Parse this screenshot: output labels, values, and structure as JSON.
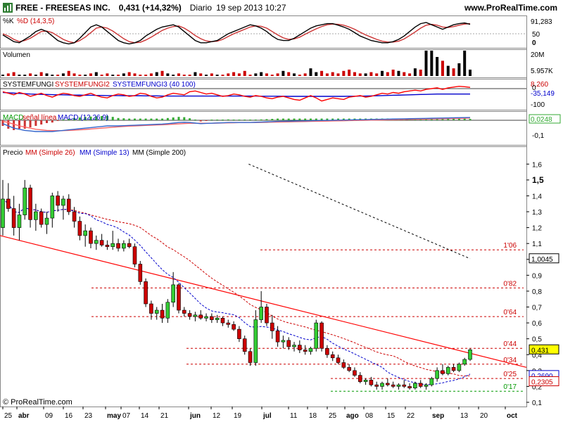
{
  "header": {
    "ticker_line": "FREE - FREESEAS INC.",
    "last_price": "0,431 (+14,32%)",
    "period": "Diario",
    "timestamp": "19 sep 2013 10:27",
    "site": "www.ProRealTime.com"
  },
  "footer": "© ProRealTime.com",
  "colors": {
    "up": "#33cc33",
    "down": "#cc0000",
    "mm26": "#cc0000",
    "mm13": "#0000cc",
    "mm200": "#000000",
    "trendline": "#ff0000",
    "level": "#cc0000",
    "support": "#009900"
  },
  "x_axis": {
    "labels": [
      "25",
      "abr",
      "09",
      "16",
      "23",
      "may",
      "07",
      "14",
      "21",
      "jun",
      "12",
      "19",
      "jul",
      "11",
      "18",
      "25",
      "ago",
      "08",
      "15",
      "22",
      "sep",
      "13",
      "20",
      "oct"
    ]
  },
  "panels": {
    "stoch": {
      "label_k": "%K",
      "label_d": "%D (14,3,5)",
      "value": "91,283",
      "ticks": [
        "50",
        "0"
      ],
      "k": [
        45,
        30,
        15,
        10,
        25,
        40,
        60,
        70,
        60,
        40,
        20,
        10,
        5,
        10,
        30,
        55,
        80,
        90,
        80,
        60,
        40,
        20,
        10,
        5,
        10,
        20,
        40,
        55,
        70,
        80,
        85,
        90,
        80,
        60,
        40,
        20,
        10,
        10,
        15,
        20,
        35,
        50,
        60,
        70,
        80,
        90,
        85,
        75,
        60,
        40,
        25,
        20,
        20,
        30,
        45,
        60,
        75,
        85,
        90,
        95,
        95,
        88,
        80,
        70,
        55,
        40,
        30,
        20,
        15,
        10,
        10,
        15,
        25,
        40,
        60,
        80,
        95,
        100,
        90,
        80,
        70,
        80,
        90,
        95,
        98,
        92
      ],
      "d": [
        50,
        40,
        25,
        15,
        20,
        30,
        45,
        60,
        62,
        55,
        40,
        25,
        15,
        10,
        20,
        35,
        55,
        75,
        80,
        75,
        62,
        45,
        28,
        15,
        10,
        12,
        22,
        35,
        50,
        65,
        75,
        82,
        85,
        75,
        60,
        42,
        28,
        18,
        15,
        17,
        25,
        38,
        50,
        60,
        70,
        80,
        85,
        83,
        75,
        60,
        45,
        32,
        25,
        27,
        35,
        48,
        60,
        72,
        82,
        90,
        93,
        92,
        88,
        80,
        70,
        57,
        45,
        35,
        25,
        17,
        13,
        13,
        17,
        27,
        42,
        58,
        75,
        88,
        92,
        88,
        80,
        78,
        82,
        88,
        93,
        95
      ]
    },
    "volume": {
      "label": "Volumen",
      "ticks": [
        "20M",
        "5.957K"
      ],
      "values": [
        1,
        2,
        3,
        1,
        1,
        2,
        1,
        3,
        2,
        1,
        1,
        2,
        4,
        2,
        1,
        1,
        2,
        3,
        1,
        2,
        1,
        1,
        2,
        3,
        2,
        1,
        1,
        2,
        3,
        4,
        2,
        1,
        2,
        1,
        1,
        3,
        2,
        1,
        2,
        1,
        1,
        2,
        3,
        2,
        4,
        1,
        2,
        3,
        2,
        1,
        2,
        4,
        3,
        2,
        1,
        2,
        6,
        3,
        4,
        2,
        3,
        2,
        4,
        5,
        3,
        2,
        2,
        3,
        2,
        4,
        3,
        5,
        4,
        3,
        2,
        6,
        5,
        20,
        20,
        15,
        12,
        8,
        6,
        10,
        20,
        5
      ]
    },
    "sysfungi": {
      "label_1": "SYSTEMFUNGI",
      "label_2": "SYSTEMFUNGI2",
      "label_3": "SYSTEMFUNGI3 (40 100)",
      "value_1": "8,260",
      "value_2": "-35,149",
      "ticks": [
        "0",
        "-100"
      ],
      "red": [
        -20,
        -30,
        -40,
        -25,
        -35,
        -50,
        -40,
        -30,
        -45,
        -55,
        -40,
        -30,
        -35,
        -45,
        -50,
        -40,
        -30,
        -45,
        -55,
        -60,
        -45,
        -35,
        -40,
        -50,
        -45,
        -30,
        -35,
        -50,
        -60,
        -55,
        -40,
        -30,
        -35,
        -40,
        -20,
        -15,
        -25,
        -35,
        -30,
        -40,
        -50,
        -45,
        -35,
        -40,
        -50,
        -55,
        -45,
        -50,
        -60,
        -65,
        -55,
        -50,
        -60,
        -70,
        -75,
        -60,
        -45,
        -60,
        -80,
        -70,
        -60,
        -65,
        -70,
        -55,
        -50,
        -45,
        -55,
        -50,
        -40,
        -30,
        -35,
        -25,
        -30,
        -20,
        -15,
        -10,
        -15,
        -5,
        0,
        5,
        -5,
        5,
        10,
        15,
        12,
        8
      ],
      "blue": [
        -25,
        -27,
        -29,
        -31,
        -33,
        -35,
        -36,
        -37,
        -38,
        -39,
        -40,
        -40,
        -41,
        -42,
        -42,
        -43,
        -43,
        -44,
        -44,
        -45,
        -45,
        -45,
        -46,
        -46,
        -46,
        -46,
        -47,
        -47,
        -47,
        -48,
        -48,
        -48,
        -48,
        -48,
        -48,
        -48,
        -48,
        -48,
        -48,
        -48,
        -48,
        -48,
        -48,
        -48,
        -48,
        -48,
        -48,
        -49,
        -49,
        -49,
        -49,
        -49,
        -50,
        -50,
        -50,
        -50,
        -50,
        -50,
        -50,
        -50,
        -50,
        -50,
        -50,
        -49,
        -49,
        -48,
        -48,
        -47,
        -46,
        -45,
        -44,
        -43,
        -42,
        -41,
        -40,
        -39,
        -38,
        -37,
        -36,
        -35,
        -35,
        -35,
        -35,
        -35,
        -35,
        -35
      ]
    },
    "macd": {
      "label_1": "MACD",
      "label_2": "señal línea",
      "label_3": "MACD (12,26,9)",
      "value": "0,0248",
      "tick": "-0,1",
      "macd": [
        -0.03,
        -0.05,
        -0.07,
        -0.08,
        -0.09,
        -0.095,
        -0.1,
        -0.1,
        -0.1,
        -0.1,
        -0.095,
        -0.09,
        -0.085,
        -0.08,
        -0.075,
        -0.07,
        -0.065,
        -0.06,
        -0.055,
        -0.05,
        -0.05,
        -0.05,
        -0.048,
        -0.046,
        -0.044,
        -0.042,
        -0.04,
        -0.038,
        -0.036,
        -0.034,
        -0.03,
        -0.025,
        -0.02,
        -0.018,
        -0.02,
        -0.025,
        -0.03,
        -0.028,
        -0.026,
        -0.024,
        -0.022,
        -0.02,
        -0.02,
        -0.02,
        -0.02,
        -0.02,
        -0.018,
        -0.016,
        -0.014,
        -0.012,
        -0.01,
        -0.009,
        -0.008,
        -0.007,
        -0.006,
        -0.005,
        -0.004,
        -0.003,
        -0.002,
        -0.001,
        0,
        0.001,
        0.002,
        0.003,
        0.004,
        0.005,
        0.006,
        0.007,
        0.008,
        0.009,
        0.01,
        0.011,
        0.012,
        0.013,
        0.014,
        0.015,
        0.016,
        0.017,
        0.018,
        0.019,
        0.02,
        0.021,
        0.022,
        0.023,
        0.024,
        0.0248
      ],
      "signal": [
        -0.01,
        -0.02,
        -0.035,
        -0.05,
        -0.06,
        -0.07,
        -0.08,
        -0.085,
        -0.09,
        -0.092,
        -0.093,
        -0.092,
        -0.09,
        -0.088,
        -0.085,
        -0.082,
        -0.078,
        -0.074,
        -0.07,
        -0.066,
        -0.062,
        -0.058,
        -0.055,
        -0.052,
        -0.05,
        -0.048,
        -0.046,
        -0.044,
        -0.042,
        -0.04,
        -0.038,
        -0.035,
        -0.032,
        -0.029,
        -0.027,
        -0.026,
        -0.026,
        -0.026,
        -0.026,
        -0.025,
        -0.024,
        -0.023,
        -0.022,
        -0.021,
        -0.021,
        -0.02,
        -0.02,
        -0.019,
        -0.018,
        -0.017,
        -0.016,
        -0.015,
        -0.014,
        -0.013,
        -0.012,
        -0.011,
        -0.01,
        -0.009,
        -0.008,
        -0.007,
        -0.006,
        -0.005,
        -0.004,
        -0.003,
        -0.002,
        -0.001,
        0,
        0.001,
        0.002,
        0.003,
        0.004,
        0.005,
        0.006,
        0.007,
        0.008,
        0.009,
        0.01,
        0.011,
        0.012,
        0.013,
        0.014,
        0.015,
        0.016,
        0.017,
        0.018,
        0.02
      ]
    }
  },
  "price_panel": {
    "label": "Precio",
    "mm26": "MM (Simple 26)",
    "mm13": "MM (Simple 13)",
    "mm200": "MM (Simple 200)",
    "ticks": [
      "1,6",
      "1,5",
      "1,4",
      "1,3",
      "1,2",
      "1,1",
      "1",
      "0,9",
      "0,8",
      "0,7",
      "0,6",
      "0,5",
      "0,4",
      "0,3",
      "0,2",
      "0,1"
    ],
    "tags": [
      {
        "text": "1,0045",
        "price": 1.0045,
        "color": "#000000"
      },
      {
        "text": "0,431",
        "price": 0.431,
        "color": "#000000",
        "bg": "#ffff00"
      },
      {
        "text": "0,2690",
        "price": 0.269,
        "color": "#0000cc"
      },
      {
        "text": "0,2305",
        "price": 0.2305,
        "color": "#cc0000"
      }
    ],
    "levels": [
      {
        "label": "1'06",
        "price": 1.06
      },
      {
        "label": "0'82",
        "price": 0.82
      },
      {
        "label": "0'64",
        "price": 0.64
      },
      {
        "label": "0'44",
        "price": 0.44
      },
      {
        "label": "0'34",
        "price": 0.34
      },
      {
        "label": "0'25",
        "price": 0.25
      },
      {
        "label": "0'17",
        "price": 0.17
      }
    ]
  },
  "chart_data": {
    "type": "candlestick",
    "title": "FREE - FREESEAS INC.",
    "ylim": [
      0.1,
      1.65
    ],
    "bars": [
      {
        "o": 1.2,
        "h": 1.5,
        "l": 1.15,
        "c": 1.38
      },
      {
        "o": 1.38,
        "h": 1.48,
        "l": 1.3,
        "c": 1.32
      },
      {
        "o": 1.32,
        "h": 1.4,
        "l": 1.15,
        "c": 1.2
      },
      {
        "o": 1.2,
        "h": 1.35,
        "l": 1.12,
        "c": 1.28
      },
      {
        "o": 1.28,
        "h": 1.5,
        "l": 1.25,
        "c": 1.45
      },
      {
        "o": 1.45,
        "h": 1.47,
        "l": 1.2,
        "c": 1.25
      },
      {
        "o": 1.25,
        "h": 1.35,
        "l": 1.18,
        "c": 1.3
      },
      {
        "o": 1.3,
        "h": 1.32,
        "l": 1.2,
        "c": 1.22
      },
      {
        "o": 1.22,
        "h": 1.3,
        "l": 1.16,
        "c": 1.26
      },
      {
        "o": 1.26,
        "h": 1.42,
        "l": 1.2,
        "c": 1.4
      },
      {
        "o": 1.4,
        "h": 1.43,
        "l": 1.3,
        "c": 1.34
      },
      {
        "o": 1.34,
        "h": 1.4,
        "l": 1.25,
        "c": 1.38
      },
      {
        "o": 1.38,
        "h": 1.41,
        "l": 1.28,
        "c": 1.3
      },
      {
        "o": 1.3,
        "h": 1.33,
        "l": 1.2,
        "c": 1.24
      },
      {
        "o": 1.24,
        "h": 1.27,
        "l": 1.12,
        "c": 1.15
      },
      {
        "o": 1.15,
        "h": 1.22,
        "l": 1.08,
        "c": 1.18
      },
      {
        "o": 1.18,
        "h": 1.2,
        "l": 1.07,
        "c": 1.1
      },
      {
        "o": 1.1,
        "h": 1.15,
        "l": 1.06,
        "c": 1.12
      },
      {
        "o": 1.12,
        "h": 1.16,
        "l": 1.08,
        "c": 1.09
      },
      {
        "o": 1.09,
        "h": 1.12,
        "l": 1.06,
        "c": 1.08
      },
      {
        "o": 1.08,
        "h": 1.18,
        "l": 1.06,
        "c": 1.1
      },
      {
        "o": 1.1,
        "h": 1.13,
        "l": 1.05,
        "c": 1.07
      },
      {
        "o": 1.07,
        "h": 1.12,
        "l": 1.05,
        "c": 1.1
      },
      {
        "o": 1.1,
        "h": 1.13,
        "l": 1.07,
        "c": 1.08
      },
      {
        "o": 1.08,
        "h": 1.1,
        "l": 0.95,
        "c": 0.97
      },
      {
        "o": 0.97,
        "h": 0.99,
        "l": 0.84,
        "c": 0.86
      },
      {
        "o": 0.86,
        "h": 0.88,
        "l": 0.7,
        "c": 0.72
      },
      {
        "o": 0.72,
        "h": 0.74,
        "l": 0.62,
        "c": 0.66
      },
      {
        "o": 0.66,
        "h": 0.7,
        "l": 0.62,
        "c": 0.68
      },
      {
        "o": 0.68,
        "h": 0.72,
        "l": 0.6,
        "c": 0.63
      },
      {
        "o": 0.63,
        "h": 0.75,
        "l": 0.6,
        "c": 0.73
      },
      {
        "o": 0.73,
        "h": 0.92,
        "l": 0.7,
        "c": 0.84
      },
      {
        "o": 0.84,
        "h": 0.85,
        "l": 0.66,
        "c": 0.68
      },
      {
        "o": 0.68,
        "h": 0.7,
        "l": 0.64,
        "c": 0.66
      },
      {
        "o": 0.66,
        "h": 0.68,
        "l": 0.62,
        "c": 0.64
      },
      {
        "o": 0.64,
        "h": 0.67,
        "l": 0.61,
        "c": 0.65
      },
      {
        "o": 0.65,
        "h": 0.68,
        "l": 0.62,
        "c": 0.63
      },
      {
        "o": 0.63,
        "h": 0.66,
        "l": 0.61,
        "c": 0.64
      },
      {
        "o": 0.64,
        "h": 0.66,
        "l": 0.6,
        "c": 0.62
      },
      {
        "o": 0.62,
        "h": 0.65,
        "l": 0.6,
        "c": 0.63
      },
      {
        "o": 0.63,
        "h": 0.64,
        "l": 0.58,
        "c": 0.6
      },
      {
        "o": 0.6,
        "h": 0.62,
        "l": 0.57,
        "c": 0.59
      },
      {
        "o": 0.59,
        "h": 0.61,
        "l": 0.55,
        "c": 0.56
      },
      {
        "o": 0.56,
        "h": 0.58,
        "l": 0.48,
        "c": 0.5
      },
      {
        "o": 0.5,
        "h": 0.52,
        "l": 0.4,
        "c": 0.42
      },
      {
        "o": 0.42,
        "h": 0.44,
        "l": 0.33,
        "c": 0.35
      },
      {
        "o": 0.35,
        "h": 0.68,
        "l": 0.33,
        "c": 0.62
      },
      {
        "o": 0.62,
        "h": 0.8,
        "l": 0.6,
        "c": 0.7
      },
      {
        "o": 0.7,
        "h": 0.72,
        "l": 0.58,
        "c": 0.6
      },
      {
        "o": 0.6,
        "h": 0.65,
        "l": 0.5,
        "c": 0.55
      },
      {
        "o": 0.55,
        "h": 0.58,
        "l": 0.45,
        "c": 0.48
      },
      {
        "o": 0.48,
        "h": 0.52,
        "l": 0.44,
        "c": 0.49
      },
      {
        "o": 0.49,
        "h": 0.51,
        "l": 0.43,
        "c": 0.45
      },
      {
        "o": 0.45,
        "h": 0.48,
        "l": 0.42,
        "c": 0.46
      },
      {
        "o": 0.46,
        "h": 0.49,
        "l": 0.41,
        "c": 0.43
      },
      {
        "o": 0.43,
        "h": 0.46,
        "l": 0.4,
        "c": 0.42
      },
      {
        "o": 0.42,
        "h": 0.45,
        "l": 0.4,
        "c": 0.44
      },
      {
        "o": 0.44,
        "h": 0.62,
        "l": 0.42,
        "c": 0.6
      },
      {
        "o": 0.6,
        "h": 0.61,
        "l": 0.42,
        "c": 0.44
      },
      {
        "o": 0.44,
        "h": 0.46,
        "l": 0.38,
        "c": 0.4
      },
      {
        "o": 0.4,
        "h": 0.42,
        "l": 0.36,
        "c": 0.38
      },
      {
        "o": 0.38,
        "h": 0.4,
        "l": 0.34,
        "c": 0.35
      },
      {
        "o": 0.35,
        "h": 0.37,
        "l": 0.31,
        "c": 0.32
      },
      {
        "o": 0.32,
        "h": 0.34,
        "l": 0.29,
        "c": 0.3
      },
      {
        "o": 0.3,
        "h": 0.32,
        "l": 0.26,
        "c": 0.27
      },
      {
        "o": 0.27,
        "h": 0.29,
        "l": 0.22,
        "c": 0.23
      },
      {
        "o": 0.23,
        "h": 0.25,
        "l": 0.21,
        "c": 0.24
      },
      {
        "o": 0.24,
        "h": 0.26,
        "l": 0.2,
        "c": 0.21
      },
      {
        "o": 0.21,
        "h": 0.23,
        "l": 0.18,
        "c": 0.2
      },
      {
        "o": 0.2,
        "h": 0.23,
        "l": 0.18,
        "c": 0.22
      },
      {
        "o": 0.22,
        "h": 0.25,
        "l": 0.2,
        "c": 0.21
      },
      {
        "o": 0.21,
        "h": 0.23,
        "l": 0.19,
        "c": 0.2
      },
      {
        "o": 0.2,
        "h": 0.22,
        "l": 0.18,
        "c": 0.21
      },
      {
        "o": 0.21,
        "h": 0.24,
        "l": 0.19,
        "c": 0.2
      },
      {
        "o": 0.2,
        "h": 0.22,
        "l": 0.18,
        "c": 0.19
      },
      {
        "o": 0.19,
        "h": 0.23,
        "l": 0.18,
        "c": 0.22
      },
      {
        "o": 0.22,
        "h": 0.24,
        "l": 0.19,
        "c": 0.2
      },
      {
        "o": 0.2,
        "h": 0.22,
        "l": 0.18,
        "c": 0.21
      },
      {
        "o": 0.21,
        "h": 0.26,
        "l": 0.2,
        "c": 0.25
      },
      {
        "o": 0.25,
        "h": 0.32,
        "l": 0.23,
        "c": 0.3
      },
      {
        "o": 0.3,
        "h": 0.34,
        "l": 0.27,
        "c": 0.28
      },
      {
        "o": 0.28,
        "h": 0.33,
        "l": 0.27,
        "c": 0.32
      },
      {
        "o": 0.32,
        "h": 0.34,
        "l": 0.29,
        "c": 0.3
      },
      {
        "o": 0.3,
        "h": 0.35,
        "l": 0.29,
        "c": 0.34
      },
      {
        "o": 0.34,
        "h": 0.38,
        "l": 0.33,
        "c": 0.37
      },
      {
        "o": 0.37,
        "h": 0.44,
        "l": 0.36,
        "c": 0.431
      }
    ],
    "trendline": {
      "from": 1.15,
      "to": 0.32
    },
    "mm200": {
      "start_bar": 46,
      "from": 1.6,
      "to": 1.0045
    }
  }
}
